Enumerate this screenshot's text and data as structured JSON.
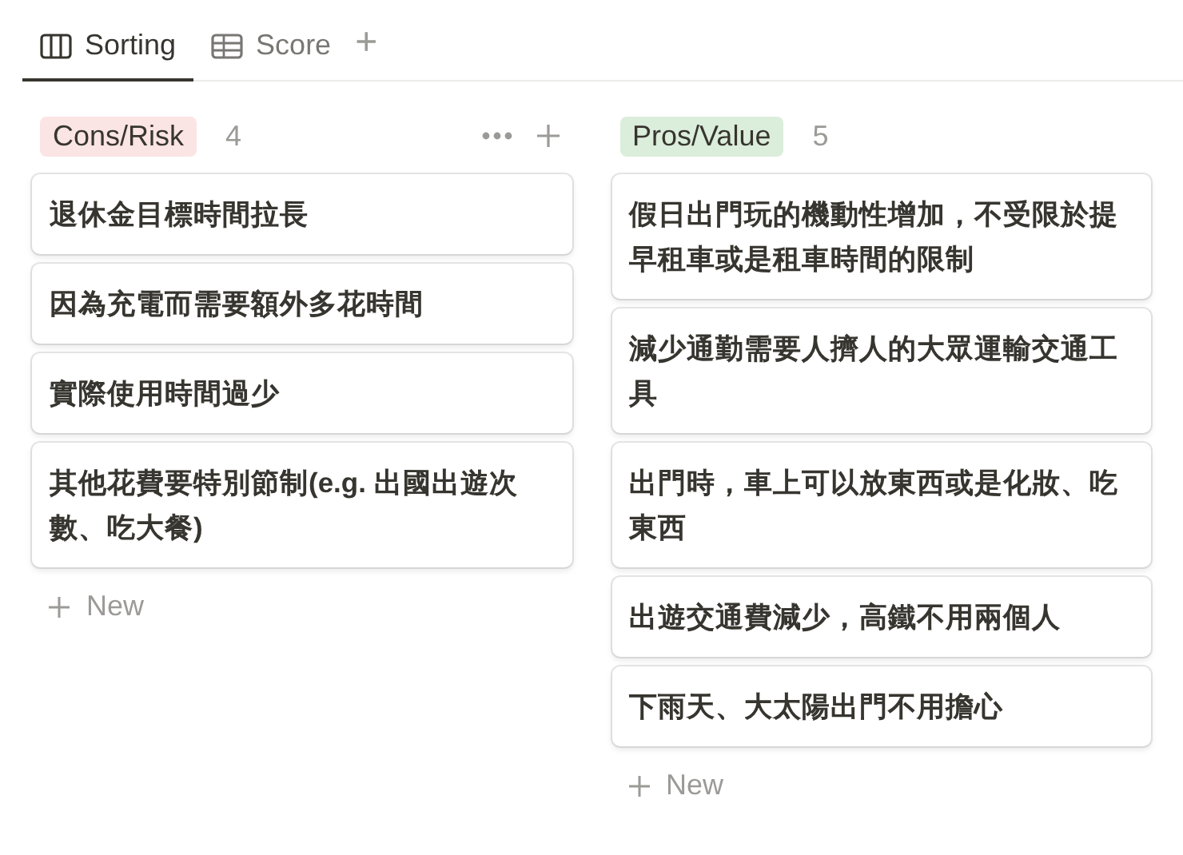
{
  "tabs": [
    {
      "label": "Sorting",
      "kind": "board",
      "selected": true
    },
    {
      "label": "Score",
      "kind": "table",
      "selected": false
    }
  ],
  "add_view": "+",
  "groups": [
    {
      "label": "Cons/Risk",
      "color": "#fbe4e4",
      "count": "4",
      "hovered": true,
      "cards": [
        "退休金目標時間拉長",
        "因為充電而需要額外多花時間",
        "實際使用時間過少",
        "其他花費要特別節制(e.g. 出國出遊次數、吃大餐)"
      ],
      "new_label": "New"
    },
    {
      "label": "Pros/Value",
      "color": "#dbeddb",
      "count": "5",
      "hovered": false,
      "cards": [
        "假日出門玩的機動性增加，不受限於提早租車或是租車時間的限制",
        "減少通勤需要人擠人的大眾運輸交通工具",
        "出門時，車上可以放東西或是化妝、吃東西",
        "出遊交通費減少，高鐵不用兩個人",
        "下雨天、大太陽出門不用擔心"
      ],
      "new_label": "New"
    }
  ]
}
